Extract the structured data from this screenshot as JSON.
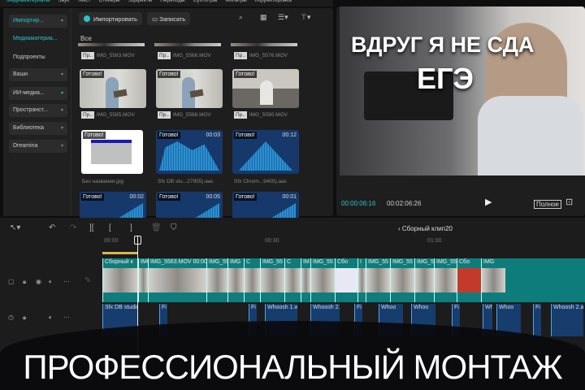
{
  "tabs": [
    "Медиаматериалы",
    "Звук",
    "Текст",
    "Стикеры",
    "Эффекты",
    "Переходы",
    "Субтитры",
    "Фильтры",
    "Корректировка"
  ],
  "sidebar": {
    "import": "Импортир...",
    "media": "Медиаматериа...",
    "subprojects": "Подпроекты",
    "yours": "Ваши",
    "ai": "ИИ-медиа...",
    "spaces": "Пространст...",
    "library": "Библиотека",
    "dreamina": "Dreamina"
  },
  "media": {
    "import_btn": "Импортировать",
    "record_btn": "Записать",
    "filter_all": "Все",
    "ready": "Готово!",
    "pr": "Пр..",
    "row0": [
      "IMG_5563.MOV",
      "IMG_5566.MOV",
      "IMG_5576.MOV"
    ],
    "row1": [
      "IMG_5585.MOV",
      "IMG_5588.MOV",
      "IMG_5590.MOV"
    ],
    "row2": [
      "Без названия.jpg",
      "Sfx DB stu...27955).aac",
      "Sfx Chrom...9405).aac"
    ],
    "row2_durations": [
      "00:03",
      "00:12"
    ],
    "row3_durations": [
      "00:02",
      "00:05",
      "00:01"
    ]
  },
  "preview": {
    "line1": "ВДРУГ Я НЕ СДА",
    "line2": "ЕГЭ",
    "current": "00:00:06:16",
    "total": "00:02:06:26",
    "full": "Полное"
  },
  "timeline": {
    "compound": "Сборный клип20",
    "ruler": [
      "00:00",
      "00:30",
      "01:00"
    ],
    "video_clips": [
      "Сборный к",
      "IMG",
      "IMG_5563.MOV 00:00:1",
      "IMG_55",
      "IMG",
      "С",
      "IMG_55",
      "С",
      "IM",
      "IMG_55",
      "Сбо",
      "I",
      "IMG_55",
      "IMG_55",
      "IMG_55",
      "IMG_55",
      "Сбо",
      "IMG"
    ],
    "audio_clips": [
      "Sfx DB studios -",
      "Fi",
      "Fi",
      "Whoosh 1.wa",
      "Whoosh 2.a",
      "Fi",
      "Whoo",
      "Whoo",
      "Fi",
      "Wh",
      "Whoo",
      "Fi",
      "Whoosh 2.a"
    ]
  },
  "caption": "ПРОФЕССИОНАЛЬНЫЙ МОНТАЖ"
}
